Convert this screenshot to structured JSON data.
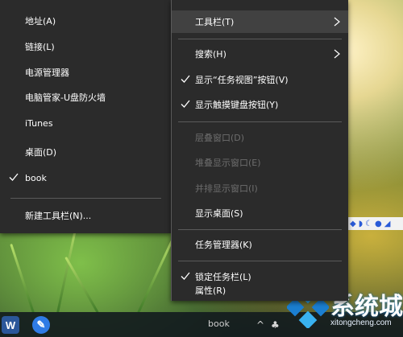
{
  "left_menu": {
    "items": [
      {
        "label": "地址(A)",
        "checked": false
      },
      {
        "label": "链接(L)",
        "checked": false
      },
      {
        "label": "电源管理器",
        "checked": false
      },
      {
        "label": "电脑管家-U盘防火墙",
        "checked": false
      },
      {
        "label": "iTunes",
        "checked": false
      },
      {
        "label": "桌面(D)",
        "checked": false
      },
      {
        "label": "book",
        "checked": true
      },
      {
        "label": "新建工具栏(N)...",
        "checked": false
      }
    ]
  },
  "right_menu": {
    "items": [
      {
        "label": "工具栏(T)",
        "submenu": true,
        "highlighted": true
      },
      {
        "label": "搜索(H)",
        "submenu": true
      },
      {
        "label": "显示“任务视图”按钮(V)",
        "checked": true
      },
      {
        "label": "显示触摸键盘按钮(Y)",
        "checked": true
      },
      {
        "label": "层叠窗口(D)",
        "disabled": true
      },
      {
        "label": "堆叠显示窗口(E)",
        "disabled": true
      },
      {
        "label": "并排显示窗口(I)",
        "disabled": true
      },
      {
        "label": "显示桌面(S)"
      },
      {
        "label": "任务管理器(K)"
      },
      {
        "label": "锁定任务栏(L)",
        "checked": true
      },
      {
        "label": "属性(R)"
      }
    ]
  },
  "taskbar": {
    "app_icons": [
      "word-icon",
      "pen-icon"
    ],
    "toolbar_label": "book",
    "app_glyphs": {
      "word": "W",
      "pen": "✎"
    }
  },
  "watermark": {
    "brand_cn": "系统城",
    "url": "xitongcheng.com"
  },
  "colors": {
    "menu_bg": "#2b2b2b",
    "menu_hover": "#414141",
    "menu_text": "#ffffff",
    "menu_disabled": "#6d6d6d",
    "separator": "#5a5a5a"
  }
}
